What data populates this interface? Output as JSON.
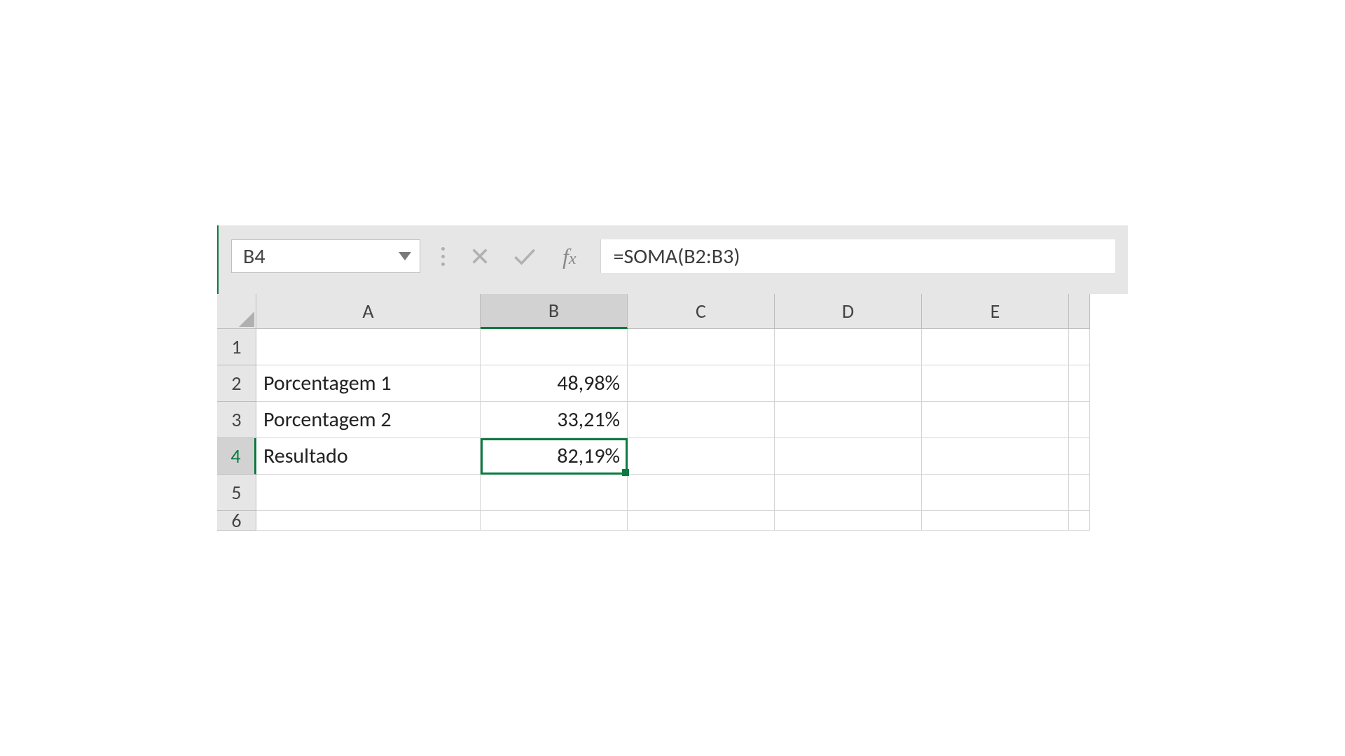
{
  "nameBox": {
    "value": "B4"
  },
  "formulaBar": {
    "formula": "=SOMA(B2:B3)"
  },
  "columns": [
    "A",
    "B",
    "C",
    "D",
    "E"
  ],
  "rows": [
    "1",
    "2",
    "3",
    "4",
    "5",
    "6"
  ],
  "selectedColumn": "B",
  "selectedRow": "4",
  "cells": {
    "A2": "Porcentagem 1",
    "A3": "Porcentagem 2",
    "A4": "Resultado",
    "B2": "48,98%",
    "B3": "33,21%",
    "B4": "82,19%"
  },
  "colors": {
    "accent": "#0b7a40",
    "headerBg": "#e6e6e6",
    "gridBorder": "#d4d4d4"
  }
}
